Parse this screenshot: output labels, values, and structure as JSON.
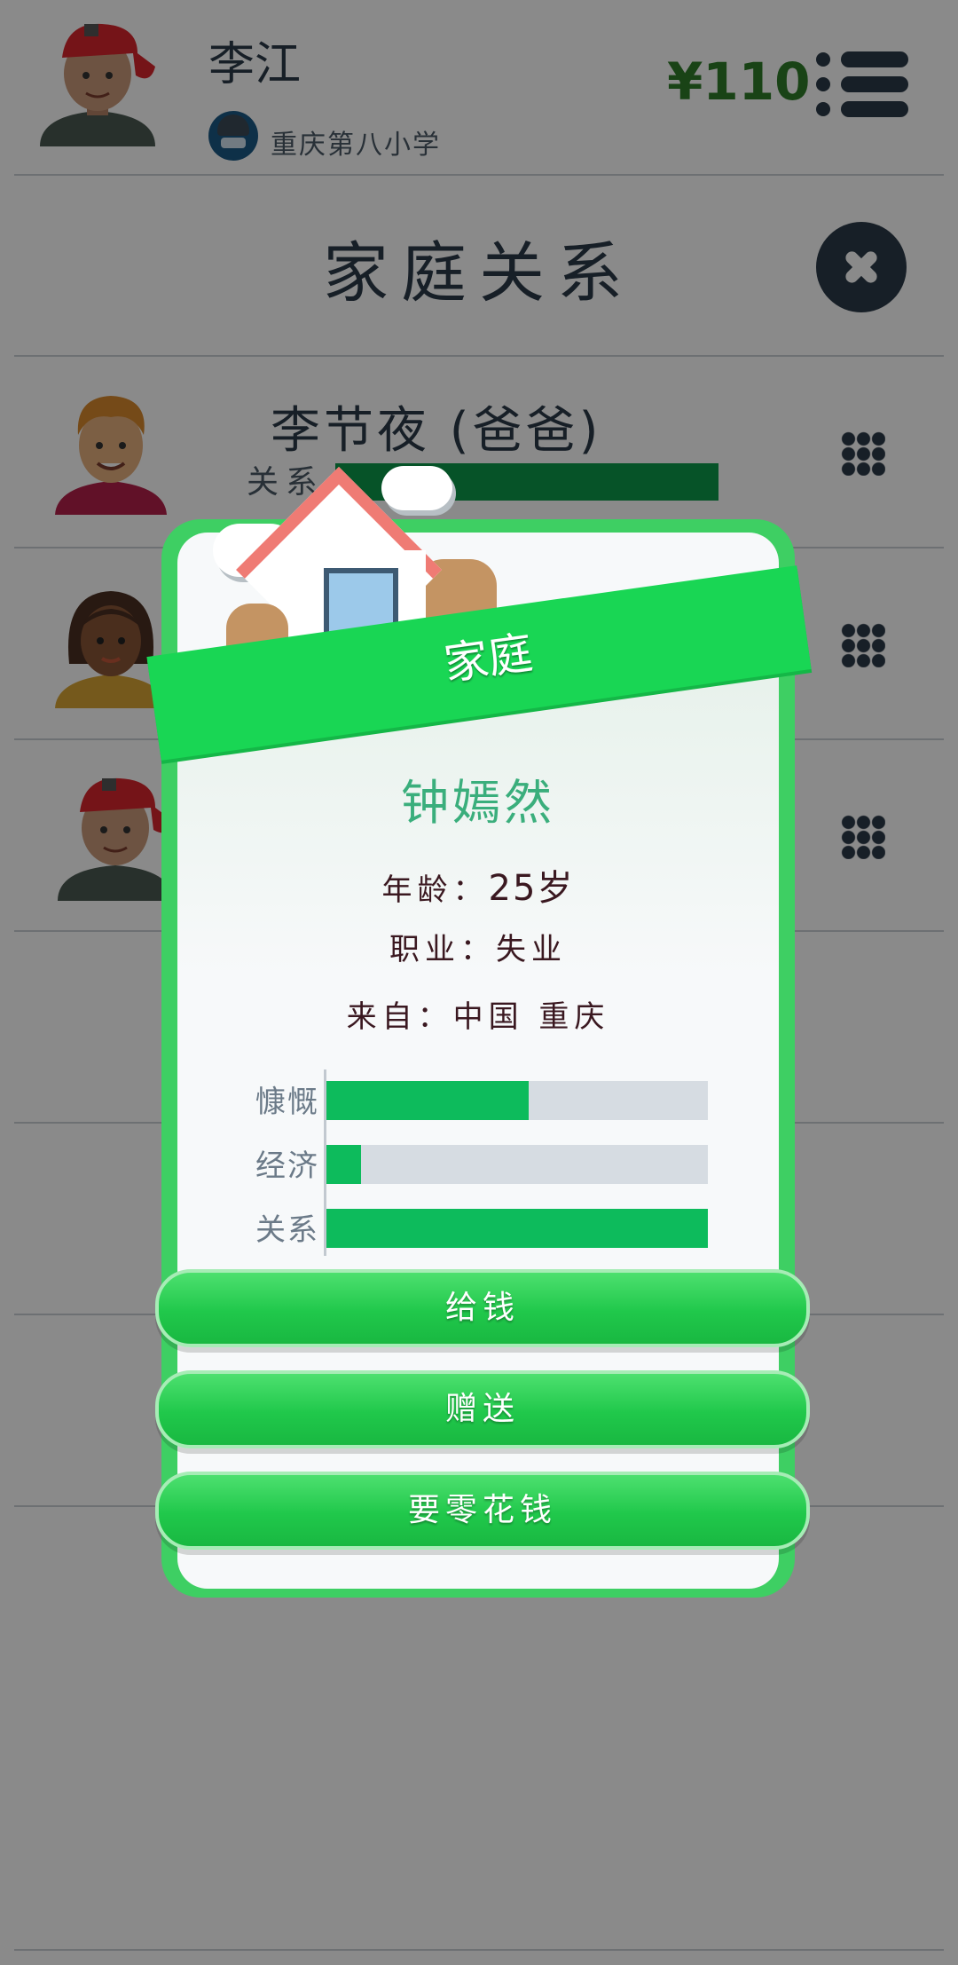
{
  "header": {
    "player_name": "李江",
    "school": "重庆第八小学",
    "money": "¥110"
  },
  "page": {
    "title": "家庭关系"
  },
  "family": [
    {
      "name": "李节夜 (爸爸)",
      "relation_label": "关系",
      "relation": 1.0
    }
  ],
  "modal": {
    "banner": "家庭",
    "name": "钟嫣然",
    "age_label": "年龄：",
    "age_value": "25岁",
    "job_label": "职业：",
    "job_value": "失业",
    "from_label": "来自：",
    "from_value": "中国 重庆",
    "stats": [
      {
        "label": "慷慨",
        "value": 0.53
      },
      {
        "label": "经济",
        "value": 0.09
      },
      {
        "label": "关系",
        "value": 1.0
      }
    ],
    "buttons": {
      "give_money": "给钱",
      "gift": "赠送",
      "ask_money": "要零花钱"
    }
  },
  "colors": {
    "money": "#2f7d2a",
    "accent_green": "#19d654",
    "stat_fill": "#0dbb5c"
  }
}
